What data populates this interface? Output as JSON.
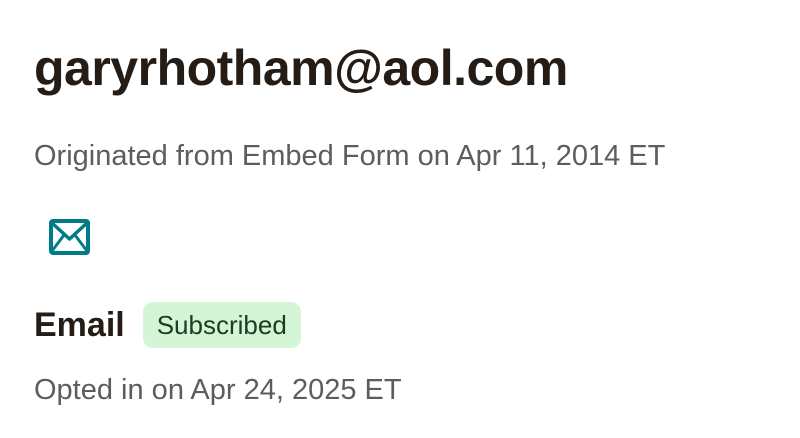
{
  "contact": {
    "email": "garyrhotham@aol.com",
    "origin": "Originated from Embed Form on Apr 11, 2014 ET"
  },
  "channel": {
    "icon": "mail-icon",
    "icon_color": "#007c89",
    "label": "Email",
    "status": "Subscribed",
    "status_bg": "#d4f5d6",
    "opt_in": "Opted in on Apr 24, 2025 ET"
  }
}
